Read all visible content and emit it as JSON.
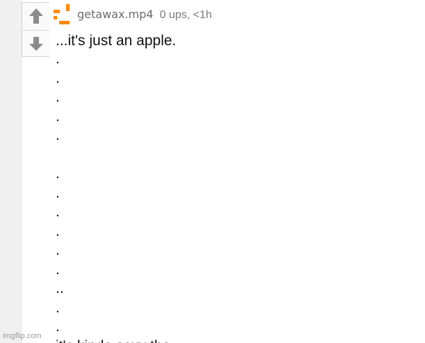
{
  "colors": {
    "accent_orange": "#ff8a00",
    "arrow_gray": "#8c8c8c",
    "panel_gray": "#f0f0f0"
  },
  "vote": {
    "upvote_icon": "arrow-up-icon",
    "downvote_icon": "arrow-down-icon"
  },
  "comment": {
    "avatar_icon": "pixel-avatar-icon",
    "username": "getawax.mp4",
    "stats": "0 ups, <1h",
    "lines": [
      "...it's just an apple.",
      ".",
      ".",
      ".",
      ".",
      ".",
      "",
      ".",
      ".",
      ".",
      ".",
      ".",
      ".",
      "..",
      ".",
      ".",
      "it's kinda sexy tho"
    ]
  },
  "watermark": "imgflip.com"
}
